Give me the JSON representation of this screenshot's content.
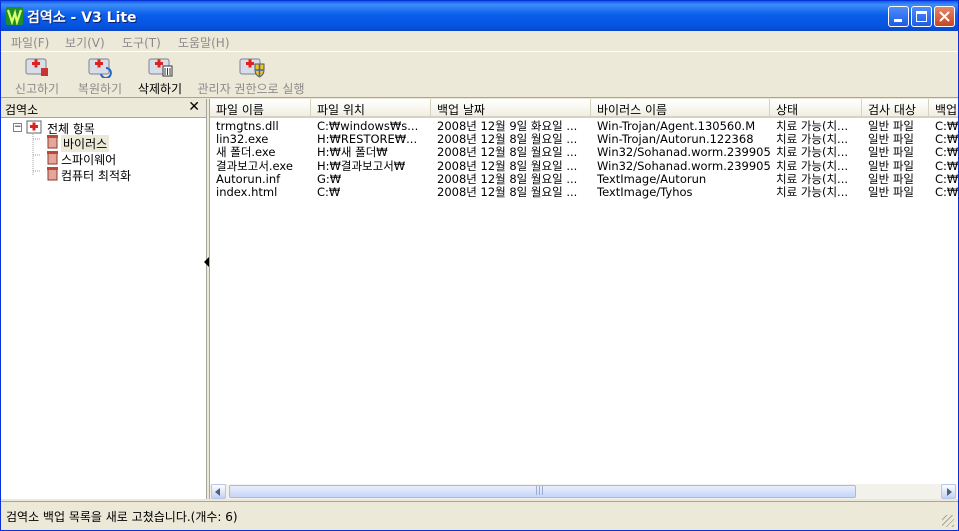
{
  "window": {
    "title": "검역소 - V3 Lite"
  },
  "menu": [
    {
      "label": "파일(F)"
    },
    {
      "label": "보기(V)"
    },
    {
      "label": "도구(T)"
    },
    {
      "label": "도움말(H)"
    }
  ],
  "toolbar": {
    "report": "신고하기",
    "restore": "복원하기",
    "delete": "삭제하기",
    "run_admin": "관리자 권한으로 실행"
  },
  "tree": {
    "header": "검역소",
    "root": "전체 항목",
    "children": [
      "바이러스",
      "스파이웨어",
      "컴퓨터 최적화"
    ]
  },
  "table": {
    "columns": [
      "파일 이름",
      "파일 위치",
      "백업 날짜",
      "바이러스 이름",
      "상태",
      "검사 대상",
      "백업"
    ],
    "rows": [
      [
        "trmgtns.dll",
        "C:₩windows₩s...",
        "2008년 12월 9일 화요일 ...",
        "Win-Trojan/Agent.130560.M",
        "치료 가능(치...",
        "일반 파일",
        "C:₩"
      ],
      [
        "lin32.exe",
        "H:₩RESTORE₩...",
        "2008년 12월 8일 월요일 ...",
        "Win-Trojan/Autorun.122368",
        "치료 가능(치...",
        "일반 파일",
        "C:₩"
      ],
      [
        "새 폴더.exe",
        "H:₩새 폴더₩",
        "2008년 12월 8일 월요일 ...",
        "Win32/Sohanad.worm.239905",
        "치료 가능(치...",
        "일반 파일",
        "C:₩"
      ],
      [
        "결과보고서.exe",
        "H:₩결과보고서₩",
        "2008년 12월 8일 월요일 ...",
        "Win32/Sohanad.worm.239905",
        "치료 가능(치...",
        "일반 파일",
        "C:₩"
      ],
      [
        "Autorun.inf",
        "G:₩",
        "2008년 12월 8일 월요일 ...",
        "TextImage/Autorun",
        "치료 가능(치...",
        "일반 파일",
        "C:₩"
      ],
      [
        "index.html",
        "C:₩",
        "2008년 12월 8일 월요일 ...",
        "TextImage/Tyhos",
        "치료 가능(치...",
        "일반 파일",
        "C:₩"
      ]
    ]
  },
  "scrollbar": {
    "grip": "|||"
  },
  "status": {
    "text": "검역소 백업 목록을 새로 고쳤습니다.(개수: 6)"
  }
}
